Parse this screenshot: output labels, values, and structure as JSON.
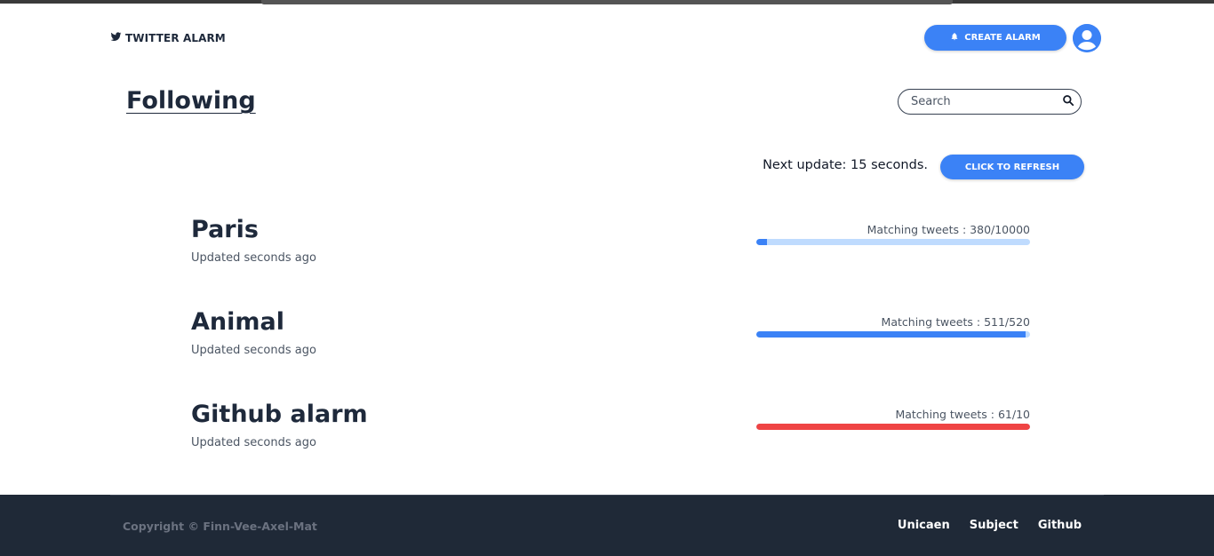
{
  "header": {
    "brand": "TWITTER ALARM",
    "create_label": "CREATE ALARM"
  },
  "main": {
    "title": "Following",
    "search_placeholder": "Search",
    "next_update": "Next update: 15 seconds.",
    "refresh_label": "CLICK TO REFRESH"
  },
  "alarms": [
    {
      "name": "Paris",
      "updated": "Updated seconds ago",
      "count_text": "Matching tweets : 380/10000",
      "progress": 0.038,
      "over": false
    },
    {
      "name": "Animal",
      "updated": "Updated seconds ago",
      "count_text": "Matching tweets : 511/520",
      "progress": 0.983,
      "over": false
    },
    {
      "name": "Github alarm",
      "updated": "Updated seconds ago",
      "count_text": "Matching tweets : 61/10",
      "progress": 1.0,
      "over": true
    }
  ],
  "footer": {
    "copyright": "Copyright © Finn-Vee-Axel-Mat",
    "links": [
      "Unicaen",
      "Subject",
      "Github"
    ]
  },
  "colors": {
    "accent": "#3b82f6",
    "bar_track": "#bfdbfe",
    "over_limit": "#ef4444",
    "footer_bg": "#1f2937"
  },
  "icons": {
    "brand": "twitter-icon",
    "create": "bell-icon",
    "search": "search-icon",
    "avatar": "user-icon"
  }
}
